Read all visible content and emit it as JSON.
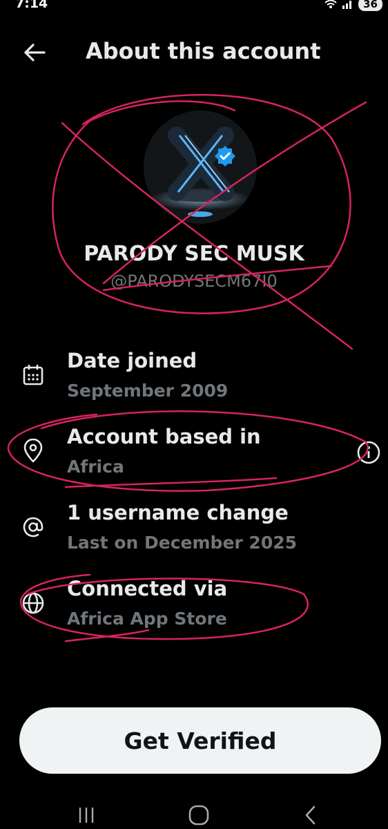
{
  "status_bar": {
    "time": "7:14",
    "battery": "36"
  },
  "header": {
    "title": "About this account"
  },
  "profile": {
    "name": "PARODY SEC MUSK",
    "handle": "@PARODYSECM67I0"
  },
  "info_items": [
    {
      "icon": "calendar-icon",
      "title": "Date joined",
      "subtitle": "September 2009"
    },
    {
      "icon": "location-pin-icon",
      "title": "Account based in",
      "subtitle": "Africa"
    },
    {
      "icon": "at-sign-icon",
      "title": "1 username change",
      "subtitle": "Last on December 2025"
    },
    {
      "icon": "globe-icon",
      "title": "Connected via",
      "subtitle": "Africa App Store"
    }
  ],
  "verify": {
    "label": "Get Verified"
  },
  "colors": {
    "background": "#000000",
    "primary_text": "#e7e9ea",
    "secondary_text": "#71767b",
    "verified_badge": "#1d9bf0",
    "annotation_ink": "#d8245e",
    "button_bg": "#eff3f4"
  }
}
